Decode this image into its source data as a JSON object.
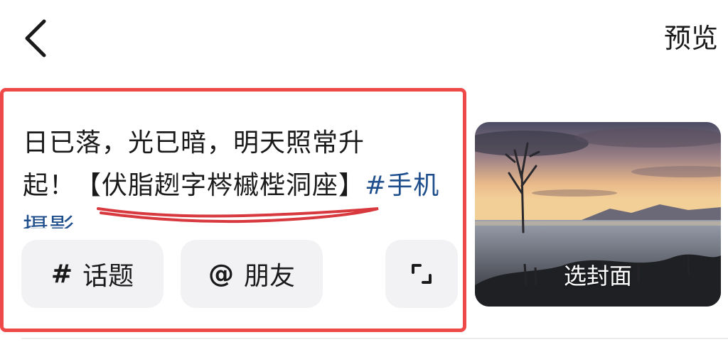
{
  "header": {
    "back_icon": "chevron-left-icon",
    "preview_label": "预览"
  },
  "caption": {
    "line1": "日已落，光已暗，明天照常升",
    "line2_prefix": "起！",
    "bracket_text": "【伏脂趔字梣槭梐洞座】",
    "hashtag": "#手机摄影"
  },
  "actions": {
    "topic_symbol": "#",
    "topic_label": "话题",
    "friend_symbol": "@",
    "friend_label": "朋友",
    "expand_icon": "expand-corners-icon"
  },
  "cover": {
    "label": "选封面"
  },
  "colors": {
    "highlight_border": "#ef4a4a",
    "hashtag": "#1f4e8c",
    "chip_bg": "#f2f2f4",
    "underline": "#d8393f"
  }
}
